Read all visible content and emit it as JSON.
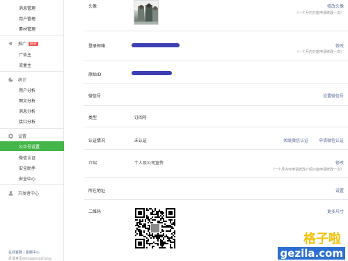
{
  "sidebar": {
    "mgmt_items": [
      "消息管理",
      "用户管理",
      "素材管理"
    ],
    "ads_group": {
      "label": "推广",
      "badge": "NEW",
      "items": [
        "广告主",
        "流量主"
      ]
    },
    "stats_group": {
      "label": "统计",
      "items": [
        "用户分析",
        "图文分析",
        "消息分析",
        "接口分析"
      ]
    },
    "settings_group": {
      "label": "设置",
      "items": [
        "公众号设置",
        "微信认证",
        "安全助手",
        "安全中心"
      ]
    },
    "dev_center": "开发者中心",
    "footer": {
      "link1": "在线客服",
      "sep": "|",
      "link2": "客服中心",
      "line2": "反馈意见ebinggongzhong"
    },
    "active_color": "#44b549"
  },
  "rows": {
    "avatar": {
      "label": "头像",
      "action": "修改头像",
      "note": "（一个月内只能申请修改一次）"
    },
    "email": {
      "label": "登录邮箱",
      "action": "修改",
      "note": "（一个月内只能申请修改一次）"
    },
    "original_id": {
      "label": "原始ID"
    },
    "wechat_id": {
      "label": "微信号",
      "action": "设置微信号"
    },
    "type": {
      "label": "类型",
      "value": "订阅号"
    },
    "verification": {
      "label": "认证情况",
      "value": "未认证",
      "action1": "关联微信认证",
      "action2": "申请微信认证"
    },
    "intro": {
      "label": "介绍",
      "value": "个人及公司宣传",
      "action": "修改",
      "note": "（一个月内可申请修改介绍只能申请修改一次）"
    },
    "address": {
      "label": "所在地址",
      "action": "设置"
    },
    "qrcode": {
      "label": "二维码",
      "action": "更多尺寸"
    }
  },
  "watermark": {
    "top": "格子啦",
    "bottom": "gezila.com"
  },
  "colors": {
    "link": "#576b95",
    "mask": "#3d3fb3"
  }
}
